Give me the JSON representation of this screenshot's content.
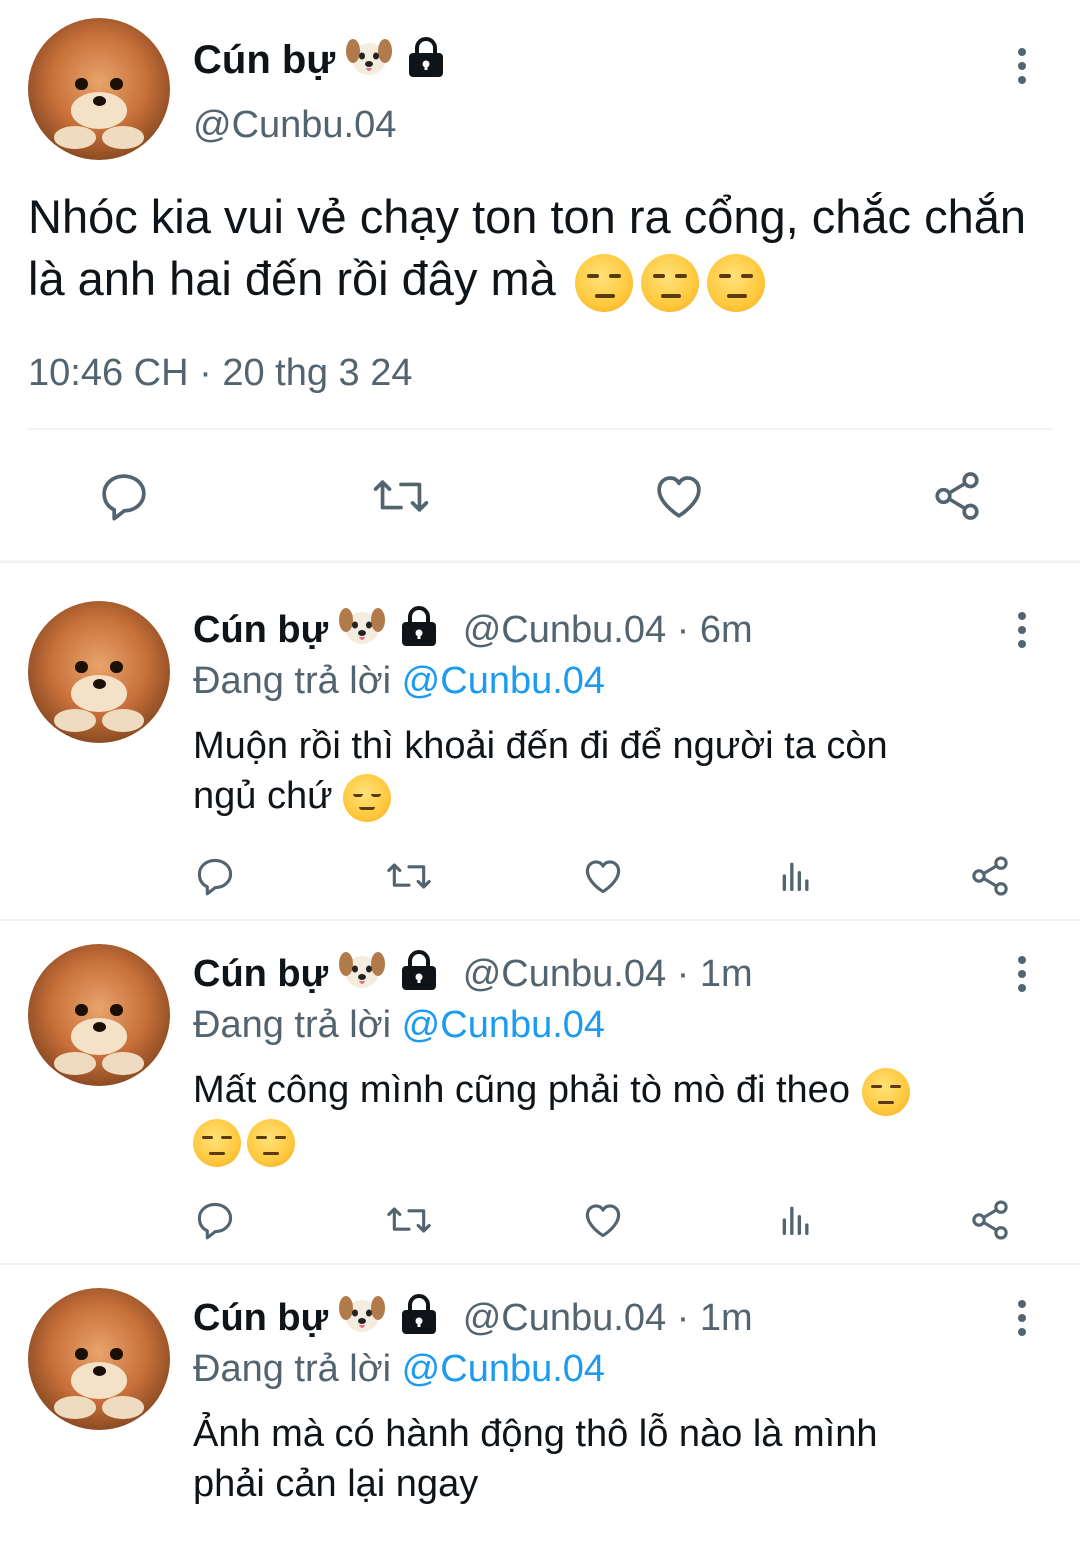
{
  "main_tweet": {
    "name": "Cún bự",
    "handle": "@Cunbu.04",
    "text": "Nhóc kia vui vẻ chạy ton ton ra cổng, chắc chắn là anh hai đến rồi đây mà",
    "time": "10:46 CH",
    "dot": "·",
    "date": "20 thg 3 24"
  },
  "replies": [
    {
      "name": "Cún bự",
      "handle": "@Cunbu.04",
      "sep": "·",
      "time": "6m",
      "replying_label": "Đang trả lời",
      "replying_to": "@Cunbu.04",
      "text_line1": "Muộn rồi thì khoải đến đi để người ta còn",
      "text_line2": "ngủ chứ"
    },
    {
      "name": "Cún bự",
      "handle": "@Cunbu.04",
      "sep": "·",
      "time": "1m",
      "replying_label": "Đang trả lời",
      "replying_to": "@Cunbu.04",
      "text_line1": "Mất công mình cũng phải tò mò đi theo",
      "text_line2": ""
    },
    {
      "name": "Cún bự",
      "handle": "@Cunbu.04",
      "sep": "·",
      "time": "1m",
      "replying_label": "Đang trả lời",
      "replying_to": "@Cunbu.04",
      "text_line1": "Ảnh mà có hành động thô lỗ nào là mình",
      "text_line2": "phải cản lại ngay"
    }
  ],
  "icons": {
    "reply": "reply-icon",
    "retweet": "retweet-icon",
    "like": "heart-icon",
    "views": "views-icon",
    "share": "share-icon",
    "more": "more-icon",
    "lock": "lock-icon",
    "dog": "dog-face-emoji"
  },
  "colors": {
    "text": "#0f1419",
    "secondary": "#536471",
    "link": "#1d9bf0",
    "divider": "#eff3f4"
  }
}
